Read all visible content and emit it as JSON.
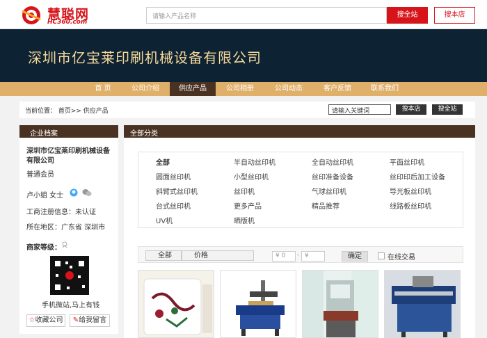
{
  "brand": {
    "logo_text": "慧聪网",
    "logo_sub": "HC360.com",
    "colors": {
      "red": "#d7141a",
      "dark": "#0d2333",
      "gold": "#e0b06a",
      "brown": "#4a3222"
    }
  },
  "search": {
    "placeholder": "请输入产品名称",
    "btn_all": "搜全站",
    "btn_store": "搜本店"
  },
  "company": {
    "name": "深圳市亿宝莱印刷机械设备有限公司"
  },
  "nav": {
    "items": [
      "首 页",
      "公司介绍",
      "供应产品",
      "公司相册",
      "公司动态",
      "客户反馈",
      "联系我们"
    ],
    "active_index": 2
  },
  "breadcrumb": {
    "text": "当前位置： 首页>> 供应产品",
    "input_value": "请输入关键词",
    "btn_store": "搜本店",
    "btn_all": "搜全站"
  },
  "sidebar": {
    "title": "企业档案",
    "company_name_line1": "深圳市亿宝莱印刷机械设备",
    "company_name_line2": "有限公司",
    "member": "普通会员",
    "contact": "卢小姐  女士",
    "registration": "工商注册信息：未认证",
    "region": "所在地区：广东省 深圳市",
    "rank_label": "商家等级：",
    "qr_caption": "手机微站,马上有钱",
    "btn_favorite": "收藏公司",
    "btn_message": "给我留言"
  },
  "main": {
    "title": "全部分类",
    "categories": [
      [
        "全部",
        "半自动丝印机",
        "全自动丝印机",
        "平面丝印机"
      ],
      [
        "圆面丝印机",
        "小型丝印机",
        "丝印准备设备",
        "丝印印后加工设备"
      ],
      [
        "斜臂式丝印机",
        "丝印机",
        "气球丝印机",
        "导光板丝印机"
      ],
      [
        "台式丝印机",
        "更多产品",
        "精品推荐",
        "线路板丝印机"
      ],
      [
        "UV机",
        "晒版机",
        "",
        ""
      ]
    ],
    "filter": {
      "tab_all": "全部",
      "tab_price": "价格",
      "min_placeholder": "¥ 0",
      "dash": "-",
      "max_placeholder": "¥",
      "confirm": "确定",
      "online_trade": "在线交易"
    }
  }
}
